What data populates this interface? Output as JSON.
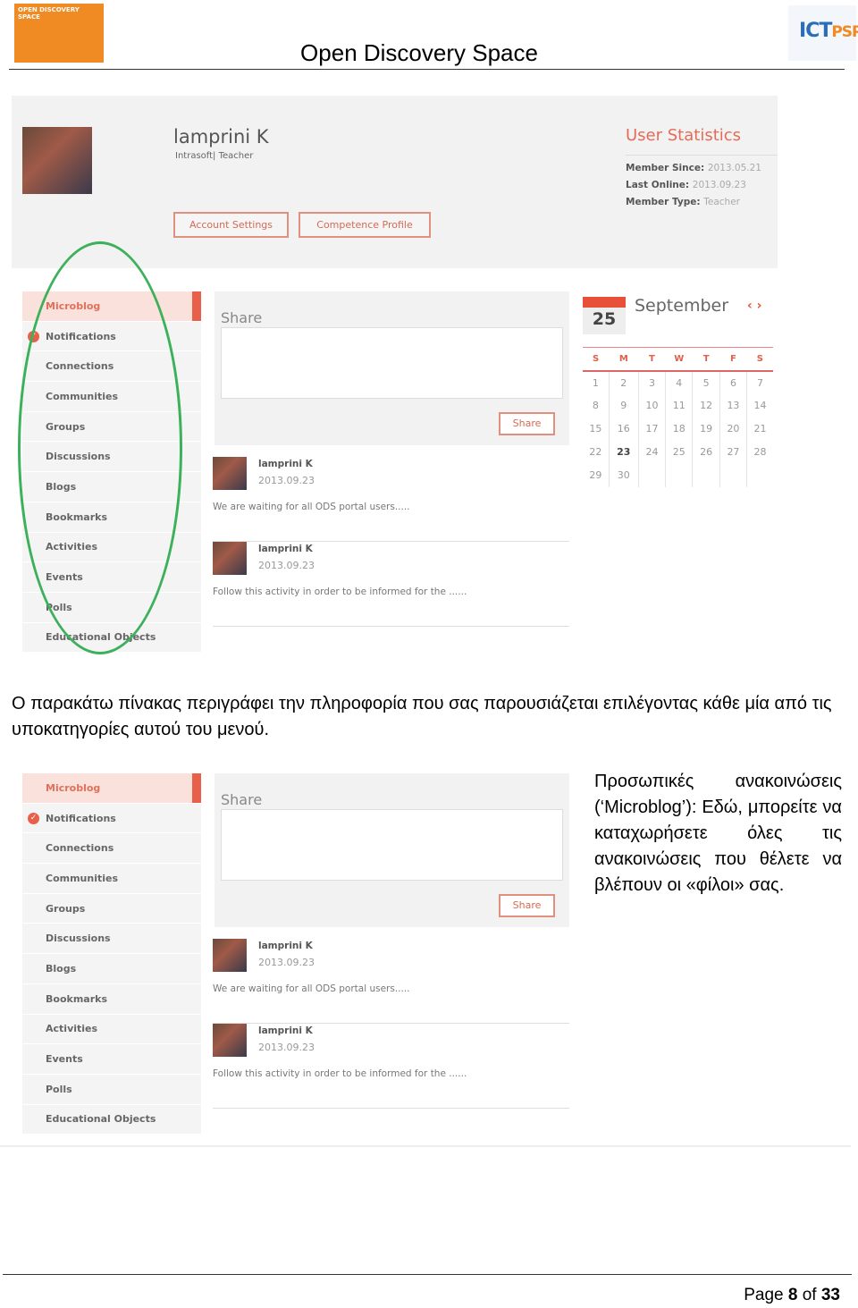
{
  "header": {
    "title": "Open Discovery Space",
    "logo_left": "OPEN DISCOVERY SPACE",
    "logo_right": "ICTPSP"
  },
  "profile": {
    "name": "lamprini K",
    "org": "Intrasoft| Teacher",
    "buttons": [
      "Account Settings",
      "Competence Profile"
    ],
    "stats_title": "User Statistics",
    "stats": [
      {
        "label": "Member Since:",
        "value": "2013.05.21"
      },
      {
        "label": "Last Online:",
        "value": "2013.09.23"
      },
      {
        "label": "Member Type:",
        "value": "Teacher"
      }
    ]
  },
  "sidebar": {
    "items": [
      "Microblog",
      "Notifications",
      "Connections",
      "Communities",
      "Groups",
      "Discussions",
      "Blogs",
      "Bookmarks",
      "Activities",
      "Events",
      "Polls",
      "Educational Objects"
    ],
    "active": "Microblog",
    "check_icon": "check-circle-icon"
  },
  "share": {
    "label": "Share",
    "button": "Share"
  },
  "posts": [
    {
      "name": "lamprini K",
      "date": "2013.09.23",
      "text": "We are waiting for all ODS portal users....."
    },
    {
      "name": "lamprini K",
      "date": "2013.09.23",
      "text": "Follow this activity in order to be informed for the ......"
    }
  ],
  "calendar": {
    "day": "25",
    "month": "September",
    "nav": "‹ ›",
    "weekdays": [
      "S",
      "M",
      "T",
      "W",
      "T",
      "F",
      "S"
    ],
    "weeks": [
      [
        "1",
        "2",
        "3",
        "4",
        "5",
        "6",
        "7"
      ],
      [
        "8",
        "9",
        "10",
        "11",
        "12",
        "13",
        "14"
      ],
      [
        "15",
        "16",
        "17",
        "18",
        "19",
        "20",
        "21"
      ],
      [
        "22",
        "23",
        "24",
        "25",
        "26",
        "27",
        "28"
      ],
      [
        "29",
        "30",
        "",
        "",
        "",
        "",
        ""
      ]
    ],
    "today": "23"
  },
  "paragraph1": "Ο παρακάτω πίνακας περιγράφει την πληροφορία που σας παρουσιάζεται επιλέγοντας κάθε μία από τις υποκατηγορίες αυτού του μενού.",
  "paragraph2": "Προσωπικές ανακοινώσεις (‘Microblog’): Εδώ, μπορείτε να καταχωρήσετε όλες τις ανακοινώσεις που θέλετε να βλέπουν οι «φίλοι» σας.",
  "footer": {
    "page_label": "Page",
    "page": "8",
    "of_label": "of",
    "total": "33"
  },
  "colors": {
    "accent": "#e8604a",
    "highlight_oval": "#3cb05a"
  }
}
